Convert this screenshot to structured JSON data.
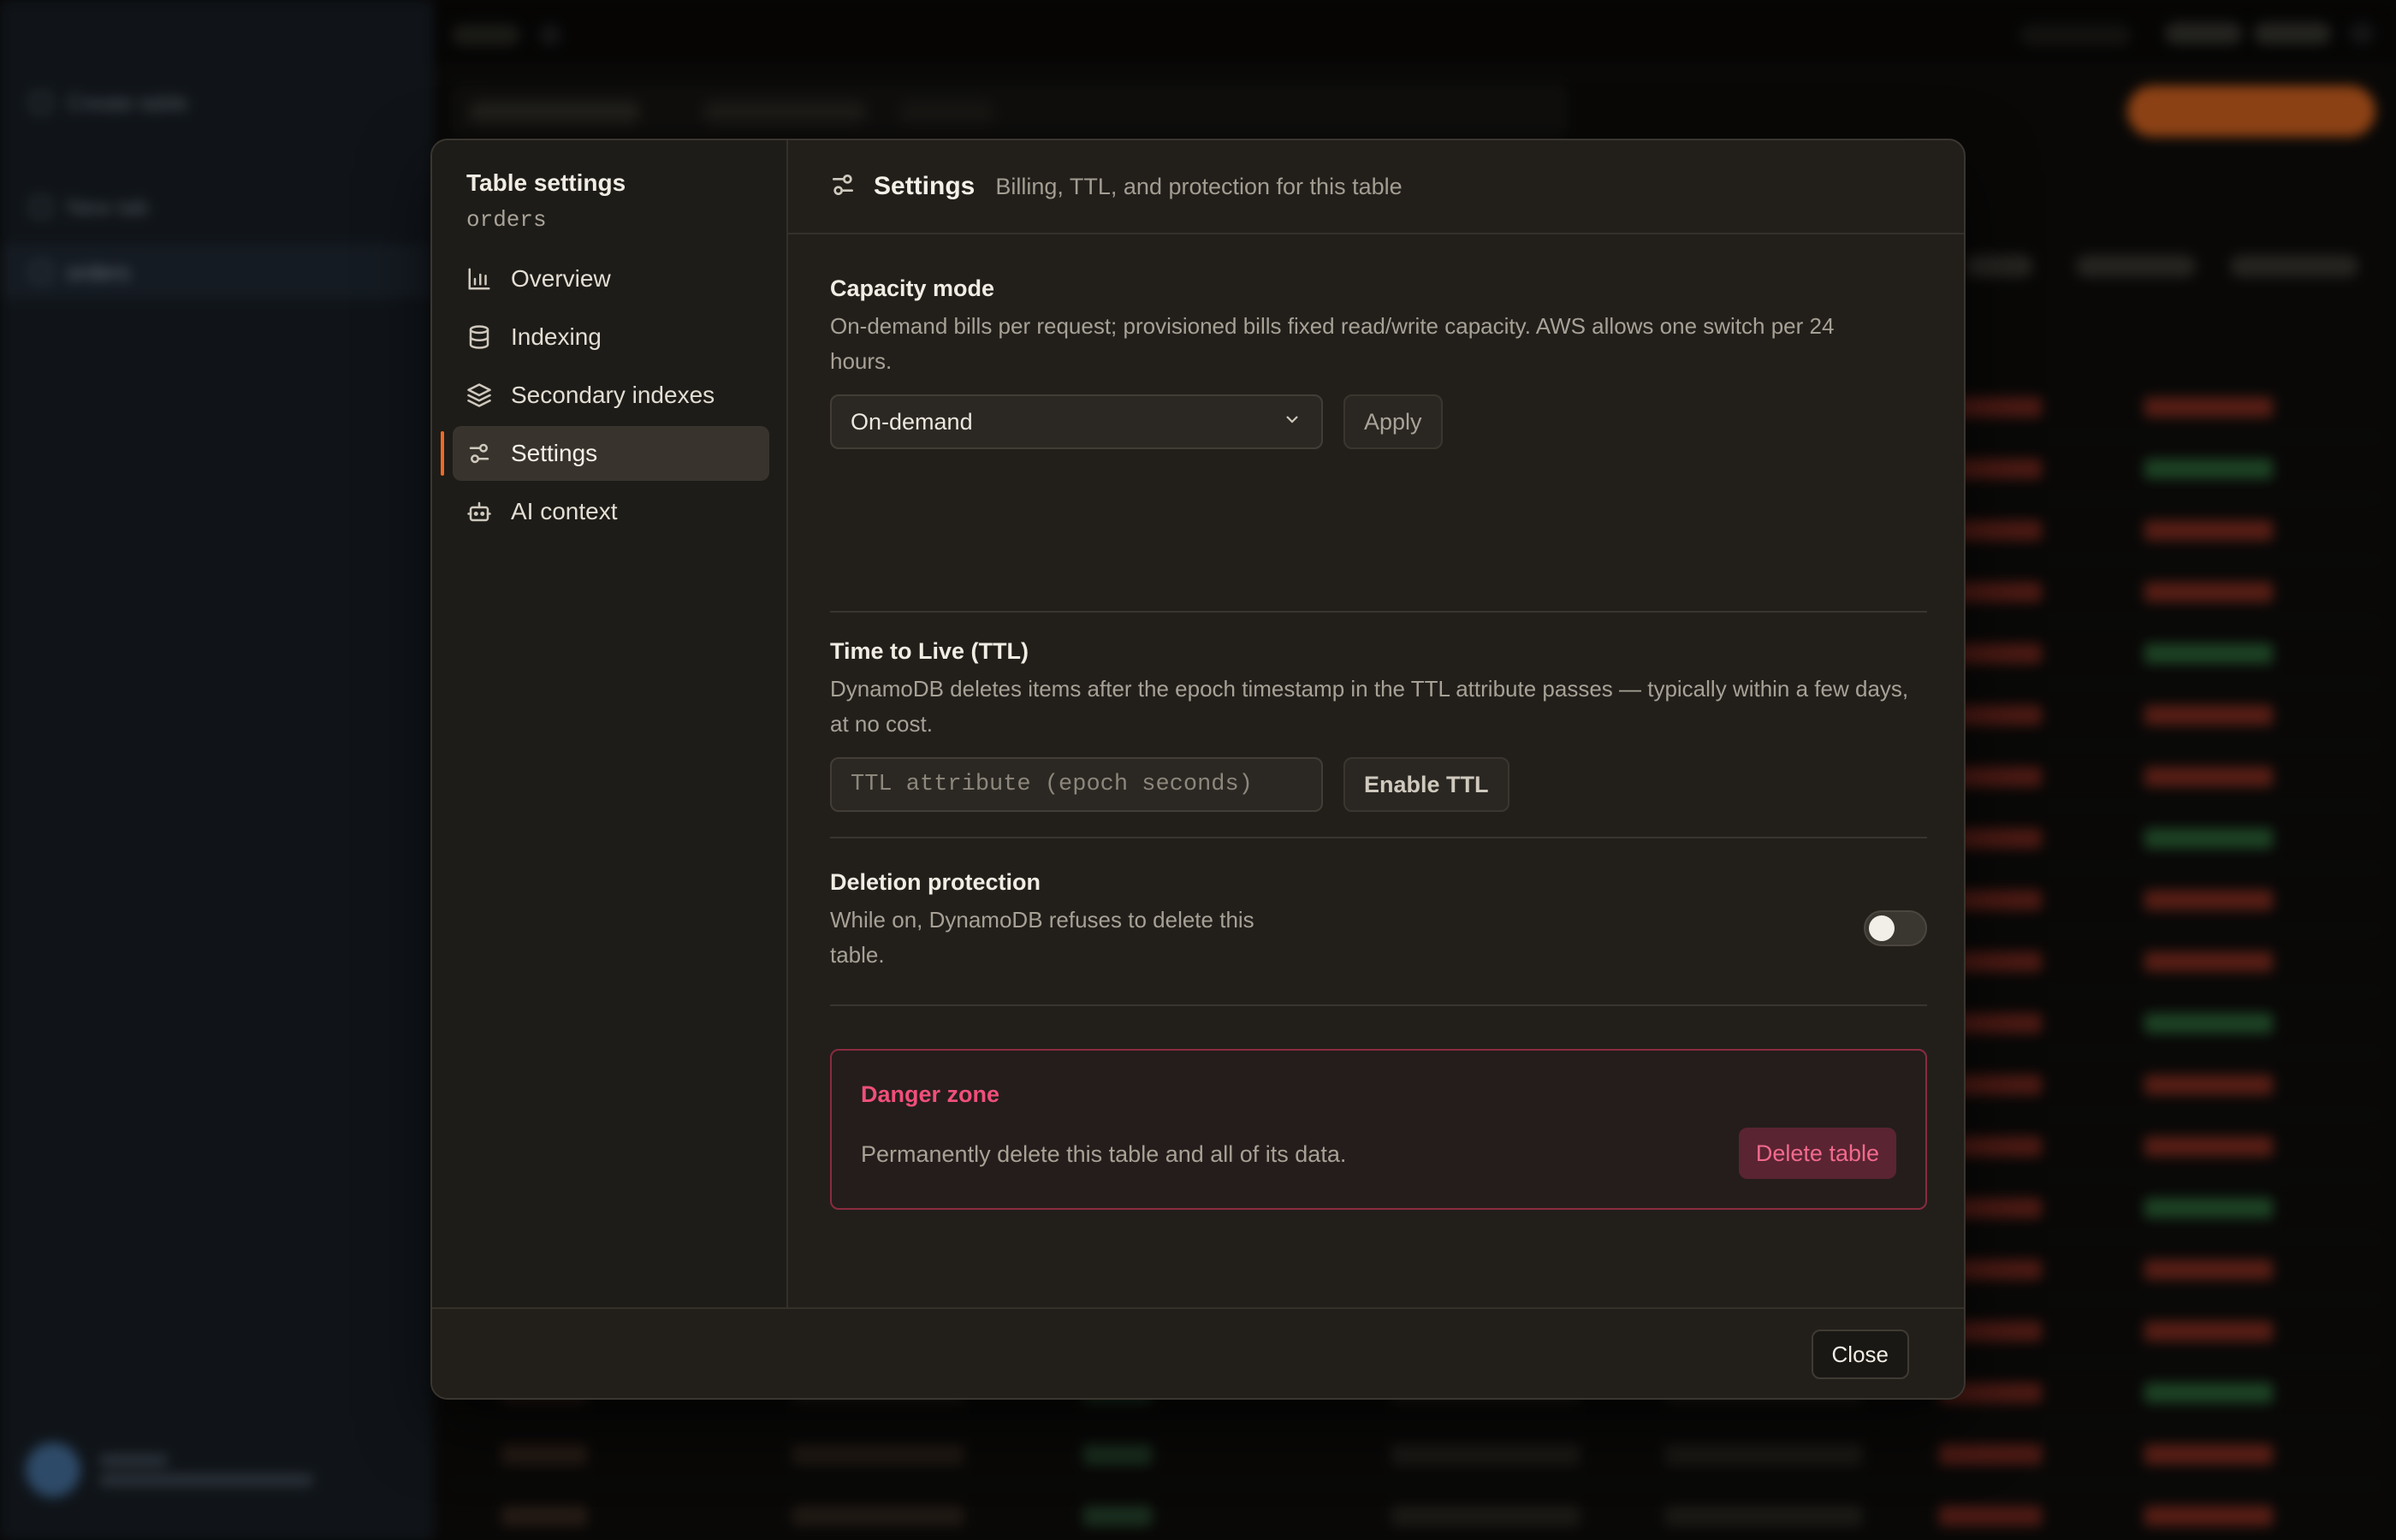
{
  "background": {
    "sidebar": {
      "create_label": "Create table",
      "new_tab_label": "New tab",
      "active_item": "orders",
      "user_name": "Demo",
      "user_sub": "free plan · 1 account"
    },
    "topbar": {
      "title": "orders",
      "pending": "Pending",
      "visual": "Visual",
      "partiql": "PartiQL"
    },
    "toolbar": {
      "key": "Primary Key",
      "filter": "customerId",
      "value": "CUST01"
    }
  },
  "modal": {
    "sidebar_title": "Table settings",
    "sidebar_sub": "orders",
    "nav": [
      {
        "label": "Overview",
        "icon": "bar-chart-icon"
      },
      {
        "label": "Indexing",
        "icon": "database-icon"
      },
      {
        "label": "Secondary indexes",
        "icon": "layers-icon"
      },
      {
        "label": "Settings",
        "icon": "sliders-icon",
        "active": true
      },
      {
        "label": "AI context",
        "icon": "robot-icon"
      }
    ],
    "header": {
      "title": "Settings",
      "subtitle": "Billing, TTL, and protection for this table"
    },
    "capacity": {
      "title": "Capacity mode",
      "desc": "On-demand bills per request; provisioned bills fixed read/write capacity. AWS allows one switch per 24 hours.",
      "selected": "On-demand",
      "apply_label": "Apply"
    },
    "ttl": {
      "title": "Time to Live (TTL)",
      "desc": "DynamoDB deletes items after the epoch timestamp in the TTL attribute passes — typically within a few days, at no cost.",
      "placeholder": "TTL attribute (epoch seconds)",
      "value": "",
      "enable_label": "Enable TTL"
    },
    "protection": {
      "title": "Deletion protection",
      "desc": "While on, DynamoDB refuses to delete this table.",
      "enabled": false
    },
    "danger": {
      "title": "Danger zone",
      "desc": "Permanently delete this table and all of its data.",
      "delete_label": "Delete table"
    },
    "close_label": "Close"
  },
  "colors": {
    "accent": "#ef6a24",
    "danger": "#ef4f7a",
    "modal_bg": "#221f1b"
  }
}
